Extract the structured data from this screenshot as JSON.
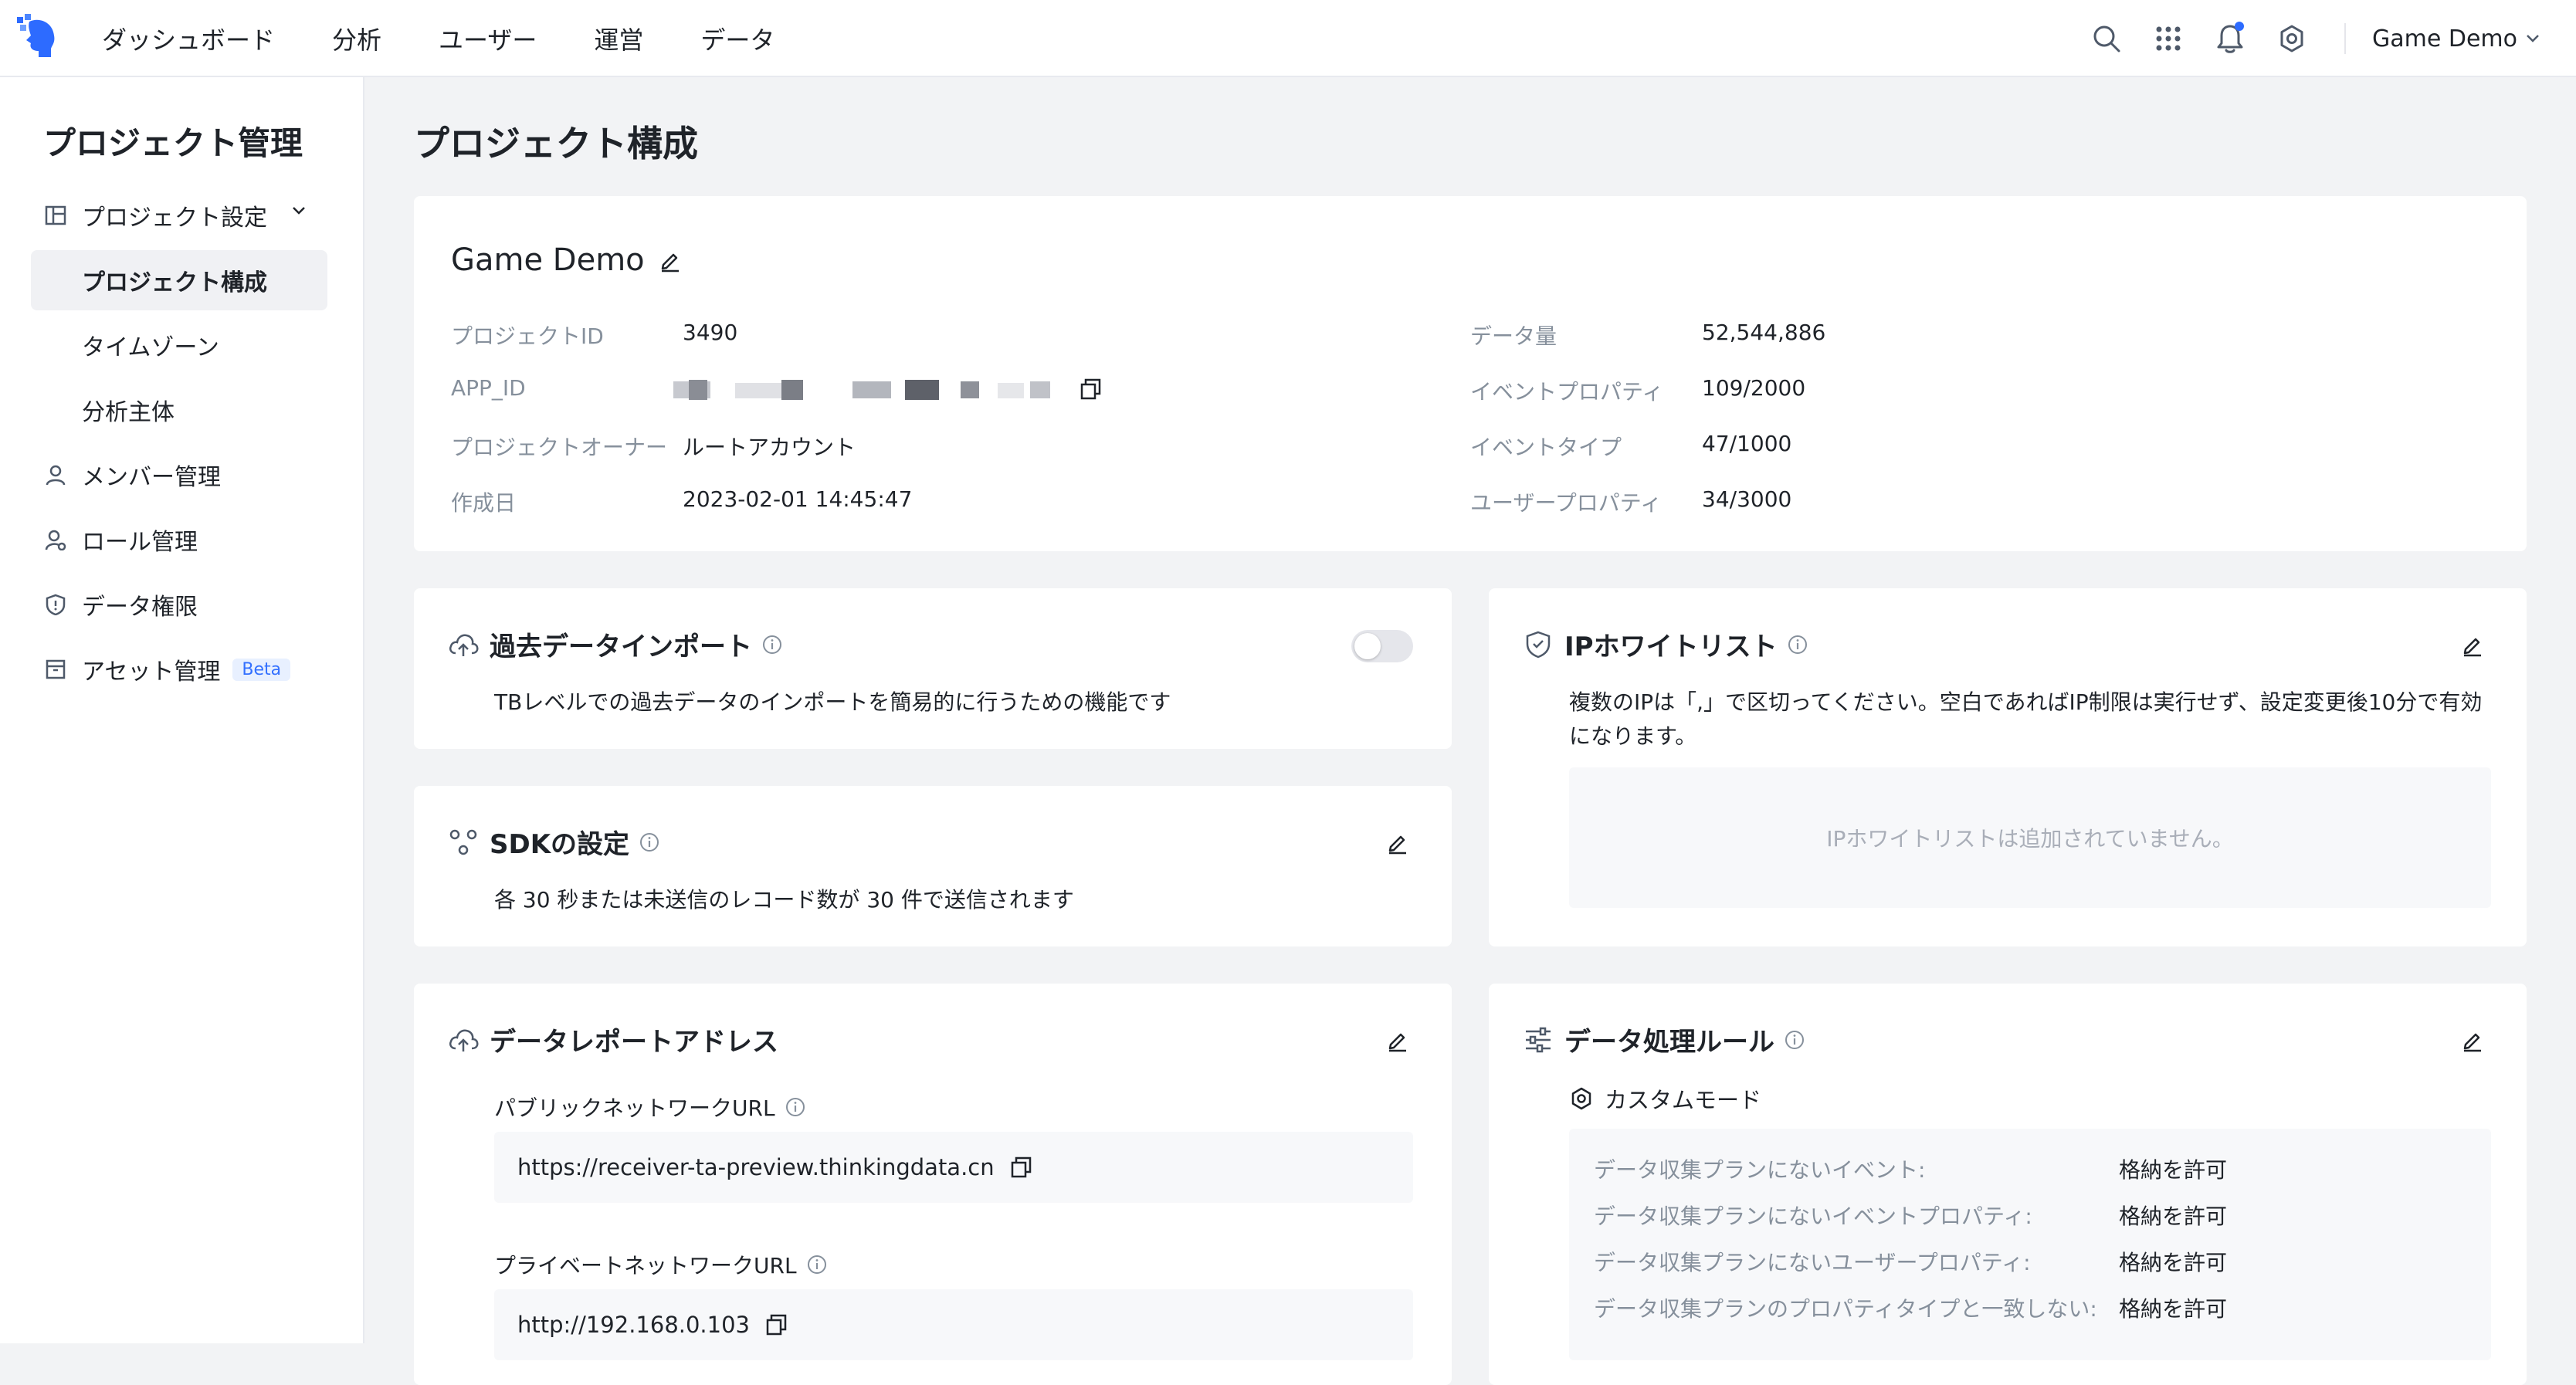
{
  "nav": {
    "items": [
      "ダッシュボード",
      "分析",
      "ユーザー",
      "運営",
      "データ"
    ],
    "project_switch": "Game Demo"
  },
  "sidebar": {
    "title": "プロジェクト管理",
    "items": [
      {
        "label": "プロジェクト設定",
        "icon": "layout-icon"
      },
      {
        "label": "プロジェクト構成"
      },
      {
        "label": "タイムゾーン"
      },
      {
        "label": "分析主体"
      },
      {
        "label": "メンバー管理",
        "icon": "user-icon"
      },
      {
        "label": "ロール管理",
        "icon": "role-icon"
      },
      {
        "label": "データ権限",
        "icon": "shield-icon"
      },
      {
        "label": "アセット管理",
        "icon": "archive-icon",
        "badge": "Beta"
      }
    ]
  },
  "page": {
    "title": "プロジェクト構成"
  },
  "overview": {
    "name": "Game Demo",
    "left": [
      {
        "key": "プロジェクトID",
        "value": "3490"
      },
      {
        "key": "APP_ID",
        "value": ""
      },
      {
        "key": "プロジェクトオーナー",
        "value": "ルートアカウント"
      },
      {
        "key": "作成日",
        "value": "2023-02-01 14:45:47"
      }
    ],
    "right": [
      {
        "key": "データ量",
        "value": "52,544,886"
      },
      {
        "key": "イベントプロパティ",
        "value": "109/2000"
      },
      {
        "key": "イベントタイプ",
        "value": "47/1000"
      },
      {
        "key": "ユーザープロパティ",
        "value": "34/3000"
      }
    ]
  },
  "import_card": {
    "title": "過去データインポート",
    "desc": "TBレベルでの過去データのインポートを簡易的に行うための機能です",
    "enabled": false
  },
  "sdk_card": {
    "title": "SDKの設定",
    "desc": "各 30 秒または未送信のレコード数が 30 件で送信されます"
  },
  "report_card": {
    "title": "データレポートアドレス",
    "public_label": "パブリックネットワークURL",
    "public_url": "https://receiver-ta-preview.thinkingdata.cn",
    "private_label": "プライベートネットワークURL",
    "private_url": "http://192.168.0.103"
  },
  "ip_card": {
    "title": "IPホワイトリスト",
    "desc": "複数のIPは「,」で区切ってください。空白であればIP制限は実行せず、設定変更後10分で有効になります。",
    "empty": "IPホワイトリストは追加されていません。"
  },
  "rules_card": {
    "title": "データ処理ルール",
    "mode": "カスタムモード",
    "rules": [
      {
        "key": "データ収集プランにないイベント:",
        "value": "格納を許可"
      },
      {
        "key": "データ収集プランにないイベントプロパティ:",
        "value": "格納を許可"
      },
      {
        "key": "データ収集プランにないユーザープロパティ:",
        "value": "格納を許可"
      },
      {
        "key": "データ収集プランのプロパティタイプと一致しない:",
        "value": "格納を許可"
      }
    ]
  },
  "colors": {
    "accent": "#3370ff",
    "text": "#1f2329",
    "muted": "#86909c",
    "bg": "#f2f3f5"
  }
}
